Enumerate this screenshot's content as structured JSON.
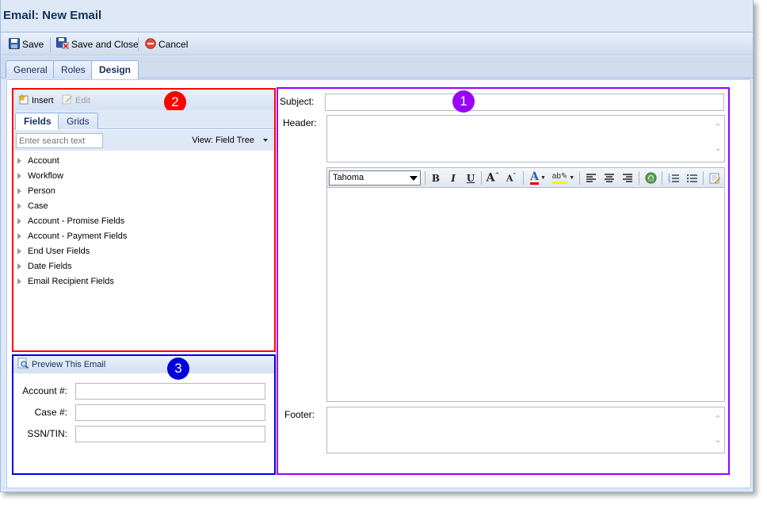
{
  "window": {
    "title": "Email: New Email"
  },
  "toolbar": {
    "save_label": "Save",
    "save_close_label": "Save and Close",
    "cancel_label": "Cancel"
  },
  "tabs": [
    {
      "label": "General",
      "active": false
    },
    {
      "label": "Roles",
      "active": false
    },
    {
      "label": "Design",
      "active": true
    }
  ],
  "fields_panel": {
    "badge": "2",
    "badge_color": "#ff0000",
    "insert_label": "Insert",
    "edit_label": "Edit",
    "tabs": [
      {
        "label": "Fields",
        "active": true
      },
      {
        "label": "Grids",
        "active": false
      }
    ],
    "search_placeholder": "Enter search text",
    "view_label": "View: Field Tree",
    "tree_items": [
      "Account",
      "Workflow",
      "Person",
      "Case",
      "Account - Promise Fields",
      "Account - Payment Fields",
      "End User Fields",
      "Date Fields",
      "Email Recipient Fields"
    ]
  },
  "preview_panel": {
    "badge": "3",
    "badge_color": "#0000dd",
    "header_label": "Preview This Email",
    "fields": [
      {
        "label": "Account #:",
        "value": ""
      },
      {
        "label": "Case #:",
        "value": ""
      },
      {
        "label": "SSN/TIN:",
        "value": ""
      }
    ]
  },
  "editor_panel": {
    "badge": "1",
    "badge_color": "#9900ff",
    "subject_label": "Subject:",
    "subject_value": "",
    "header_label": "Header:",
    "footer_label": "Footer:",
    "font_value": "Tahoma",
    "body_value": ""
  }
}
